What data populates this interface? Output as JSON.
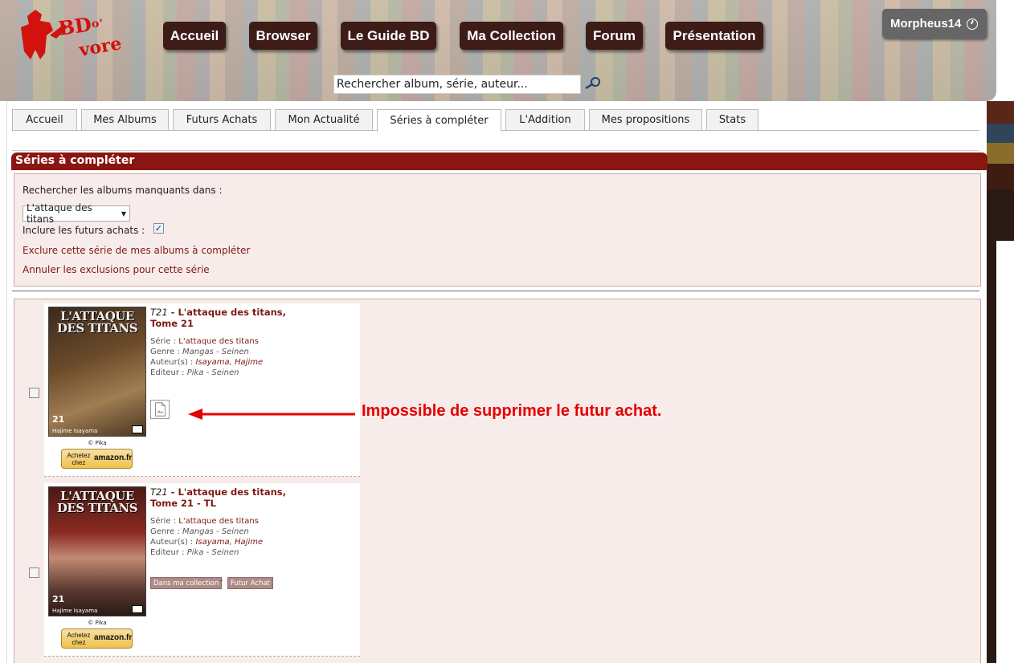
{
  "header": {
    "nav": [
      "Accueil",
      "Browser",
      "Le Guide BD",
      "Ma Collection",
      "Forum",
      "Présentation"
    ],
    "user": "Morpheus14",
    "search_placeholder": "Rechercher album, série, auteur..."
  },
  "tabs": [
    "Accueil",
    "Mes Albums",
    "Futurs Achats",
    "Mon Actualité",
    "Séries à compléter",
    "L'Addition",
    "Mes propositions",
    "Stats"
  ],
  "active_tab": "Séries à compléter",
  "section": {
    "title": "Séries à compléter",
    "search_label": "Rechercher les albums manquants dans :",
    "selected_series": "L'attaque des titans",
    "include_label": "Inclure les futurs achats :",
    "include_checked": true,
    "exclude_link": "Exclure cette série de mes albums à compléter",
    "cancel_link": "Annuler les exclusions pour cette série"
  },
  "albums": [
    {
      "tome": "T21",
      "title": "L'attaque des titans, Tome 21",
      "title_line1": "L'attaque des titans,",
      "title_line2": "Tome 21",
      "serie_label": "Série :",
      "serie": "L'attaque des titans",
      "genre_label": "Genre :",
      "genre": "Mangas - Seinen",
      "auteurs_label": "Auteur(s) :",
      "auteurs": "Isayama, Hajime",
      "editeur_label": "Editeur :",
      "editeur": "Pika - Seinen",
      "cover_title": "L'ATTAQUE DES TITANS",
      "cover_number": "21",
      "cover_author": "Hajime Isayama",
      "copyright": "© Pika",
      "amazon_text1": "Achetez chez",
      "amazon_text2": "amazon.fr"
    },
    {
      "tome": "T21",
      "title": "L'attaque des titans, Tome 21 - TL",
      "title_line1": "L'attaque des titans,",
      "title_line2": "Tome 21 - TL",
      "serie_label": "Série :",
      "serie": "L'attaque des titans",
      "genre_label": "Genre :",
      "genre": "Mangas - Seinen",
      "auteurs_label": "Auteur(s) :",
      "auteurs": "Isayama, Hajime",
      "editeur_label": "Editeur :",
      "editeur": "Pika - Seinen",
      "cover_title": "L'ATTAQUE DES TITANS",
      "cover_number": "21",
      "cover_author": "Hajime Isayama",
      "copyright": "© Pika",
      "amazon_text1": "Achetez chez",
      "amazon_text2": "amazon.fr",
      "btn_collection": "Dans ma collection",
      "btn_sep": "-",
      "btn_futur": "Futur Achat"
    }
  ],
  "annotation": "Impossible de supprimer le futur achat.",
  "colors": {
    "brand_red": "#8b1511",
    "nav_bg": "#3d1c18",
    "annotation_red": "#e50000",
    "panel_bg": "#f8ecea"
  }
}
